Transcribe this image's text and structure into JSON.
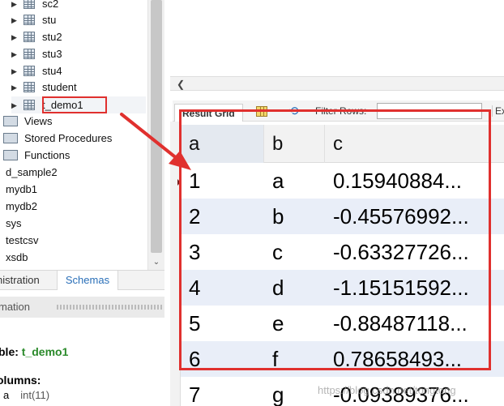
{
  "navigator": {
    "tree_items": [
      {
        "label": "sc2",
        "kind": "table"
      },
      {
        "label": "stu",
        "kind": "table"
      },
      {
        "label": "stu2",
        "kind": "table"
      },
      {
        "label": "stu3",
        "kind": "table"
      },
      {
        "label": "stu4",
        "kind": "table"
      },
      {
        "label": "student",
        "kind": "table"
      },
      {
        "label": "t_demo1",
        "kind": "table",
        "selected": true
      }
    ],
    "folders": [
      {
        "label": "Views"
      },
      {
        "label": "Stored Procedures"
      },
      {
        "label": "Functions"
      }
    ],
    "schemas": [
      "d_sample2",
      "mydb1",
      "mydb2",
      "sys",
      "testcsv",
      "xsdb"
    ],
    "tabs": {
      "administration": "nistration",
      "schemas": "Schemas"
    }
  },
  "information": {
    "header": "mation",
    "table_prefix": "ble:",
    "table_name": "t_demo1",
    "columns_label": "olumns:",
    "column1_name": "a",
    "column1_type": "int(11)"
  },
  "toolbar": {
    "result_grid": "Result Grid",
    "filter_rows": "Filter Rows:",
    "filter_value": "",
    "export": "Expo"
  },
  "grid": {
    "columns": [
      "a",
      "b",
      "c"
    ],
    "rows": [
      [
        "1",
        "a",
        "0.15940884..."
      ],
      [
        "2",
        "b",
        "-0.45576992..."
      ],
      [
        "3",
        "c",
        "-0.63327726..."
      ],
      [
        "4",
        "d",
        "-1.15151592..."
      ],
      [
        "5",
        "e",
        "-0.88487118..."
      ],
      [
        "6",
        "f",
        "0.78658493..."
      ],
      [
        "7",
        "g",
        "-0.09389376..."
      ]
    ]
  },
  "colors": {
    "annotation": "#e0302e",
    "row_alt": "#e9eef8",
    "schemas_tab": "#2a6fb8"
  },
  "watermark": "https://blog.csdn.net/tongtong"
}
